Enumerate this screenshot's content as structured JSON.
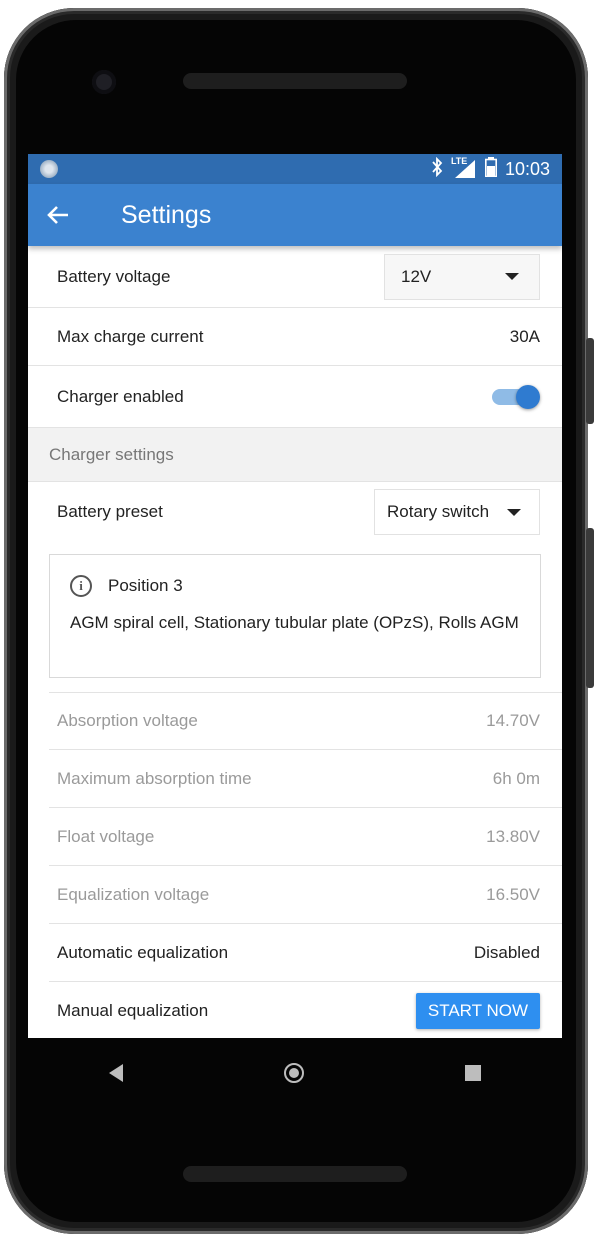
{
  "status_bar": {
    "time": "10:03",
    "icons": [
      "bluetooth-icon",
      "lte-signal-icon",
      "battery-icon"
    ],
    "lte_label": "LTE"
  },
  "app_bar": {
    "title": "Settings",
    "back_icon": "arrow-back-icon"
  },
  "rows": {
    "battery_voltage": {
      "label": "Battery voltage",
      "value": "12V"
    },
    "max_charge_current": {
      "label": "Max charge current",
      "value": "30A"
    },
    "charger_enabled": {
      "label": "Charger enabled",
      "enabled": true
    }
  },
  "section": {
    "title": "Charger settings"
  },
  "battery_preset": {
    "label": "Battery preset",
    "value": "Rotary switch"
  },
  "info": {
    "title": "Position 3",
    "text": "AGM spiral cell, Stationary tubular plate (OPzS), Rolls AGM"
  },
  "settings": {
    "absorption_voltage": {
      "label": "Absorption voltage",
      "value": "14.70V"
    },
    "max_absorption_time": {
      "label": "Maximum absorption time",
      "value": "6h 0m"
    },
    "float_voltage": {
      "label": "Float voltage",
      "value": "13.80V"
    },
    "equalization_voltage": {
      "label": "Equalization voltage",
      "value": "16.50V"
    },
    "automatic_equalization": {
      "label": "Automatic equalization",
      "value": "Disabled"
    },
    "manual_equalization": {
      "label": "Manual equalization",
      "button": "START NOW"
    }
  },
  "colors": {
    "app_bar": "#3b82cf",
    "status_bar": "#2f6cb0",
    "accent": "#2e8ff0"
  }
}
